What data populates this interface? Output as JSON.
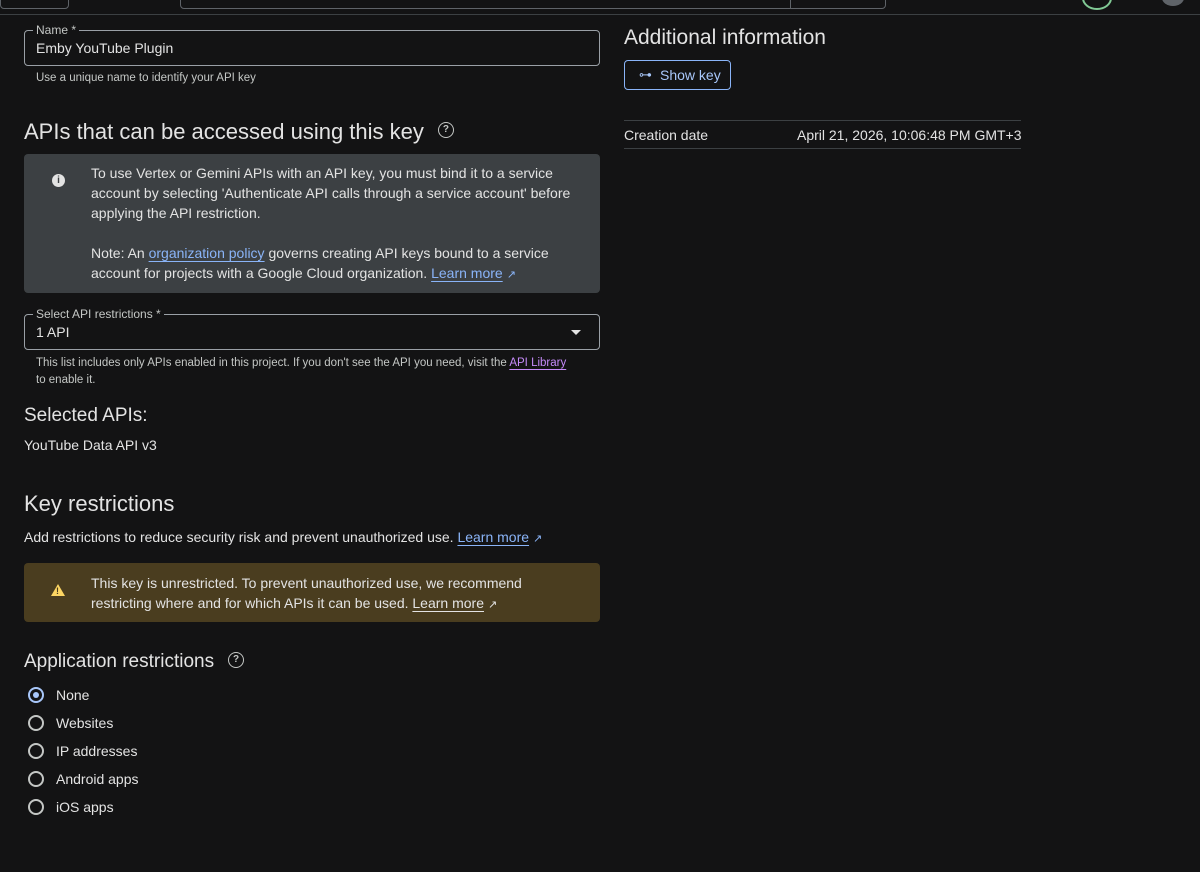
{
  "name_field": {
    "label": "Name *",
    "value": "Emby YouTube Plugin",
    "hint": "Use a unique name to identify your API key"
  },
  "apis_section": {
    "title": "APIs that can be accessed using this key",
    "help_icon": "?",
    "info_icon": "i",
    "info_line1": "To use Vertex or Gemini APIs with an API key, you must bind it to a service account by selecting 'Authenticate API calls through a service account' before applying the API restriction.",
    "note_prefix": "Note: An ",
    "note_link": "organization policy",
    "note_suffix": " governs creating API keys bound to a service account for projects with a Google Cloud organization. ",
    "learn_more": "Learn more"
  },
  "api_select": {
    "label": "Select API restrictions *",
    "value": "1 API",
    "hint_prefix": "This list includes only APIs enabled in this project. If you don't see the API you need, visit the ",
    "hint_link": "API Library",
    "hint_suffix": " to enable it."
  },
  "selected_apis": {
    "title": "Selected APIs:",
    "items": [
      "YouTube Data API v3"
    ]
  },
  "key_restrictions": {
    "title": "Key restrictions",
    "desc": "Add restrictions to reduce security risk and prevent unauthorized use. ",
    "learn_more": "Learn more",
    "warning_icon": "!",
    "warning": "This key is unrestricted. To prevent unauthorized use, we recommend restricting where and for which APIs it can be used. ",
    "warning_learn_more": "Learn more"
  },
  "app_restrictions": {
    "title": "Application restrictions",
    "help_icon": "?",
    "options": [
      "None",
      "Websites",
      "IP addresses",
      "Android apps",
      "iOS apps"
    ],
    "selected": "None"
  },
  "additional_info": {
    "title": "Additional information",
    "show_key": "Show key",
    "key_icon": "⊶",
    "creation_date_label": "Creation date",
    "creation_date_value": "April 21, 2026, 10:06:48 PM GMT+3"
  },
  "icons": {
    "external_link": "↗"
  },
  "colors": {
    "background": "#131314",
    "accent": "#8ab4f8",
    "info_bg": "#3c4043",
    "warning_bg": "#4a3d1f",
    "warning_icon": "#fdd663"
  }
}
